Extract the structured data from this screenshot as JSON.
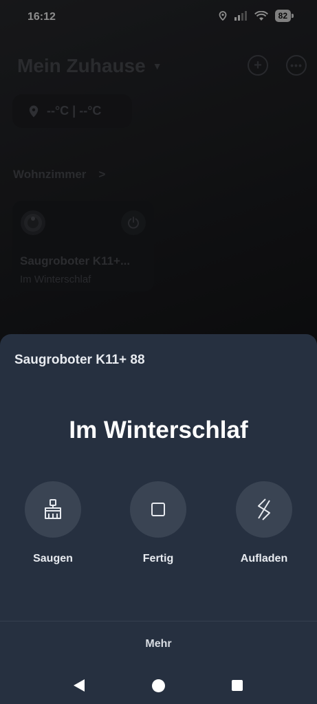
{
  "status_bar": {
    "time": "16:12",
    "battery": "82"
  },
  "home": {
    "title": "Mein Zuhause",
    "weather": "--°C | --°C",
    "room": "Wohnzimmer",
    "device": {
      "name": "Saugroboter K11+...",
      "state": "Im Winterschlaf"
    }
  },
  "sheet": {
    "device_name": "Saugroboter K11+ 88",
    "state": "Im Winterschlaf",
    "actions": [
      {
        "label": "Saugen",
        "icon": "broom-icon"
      },
      {
        "label": "Fertig",
        "icon": "stop-square-icon"
      },
      {
        "label": "Aufladen",
        "icon": "charge-icon"
      }
    ],
    "more": "Mehr"
  },
  "colors": {
    "sheet_bg": "#263040",
    "action_bg": "#3a4453",
    "page_bg": "#17181b"
  }
}
